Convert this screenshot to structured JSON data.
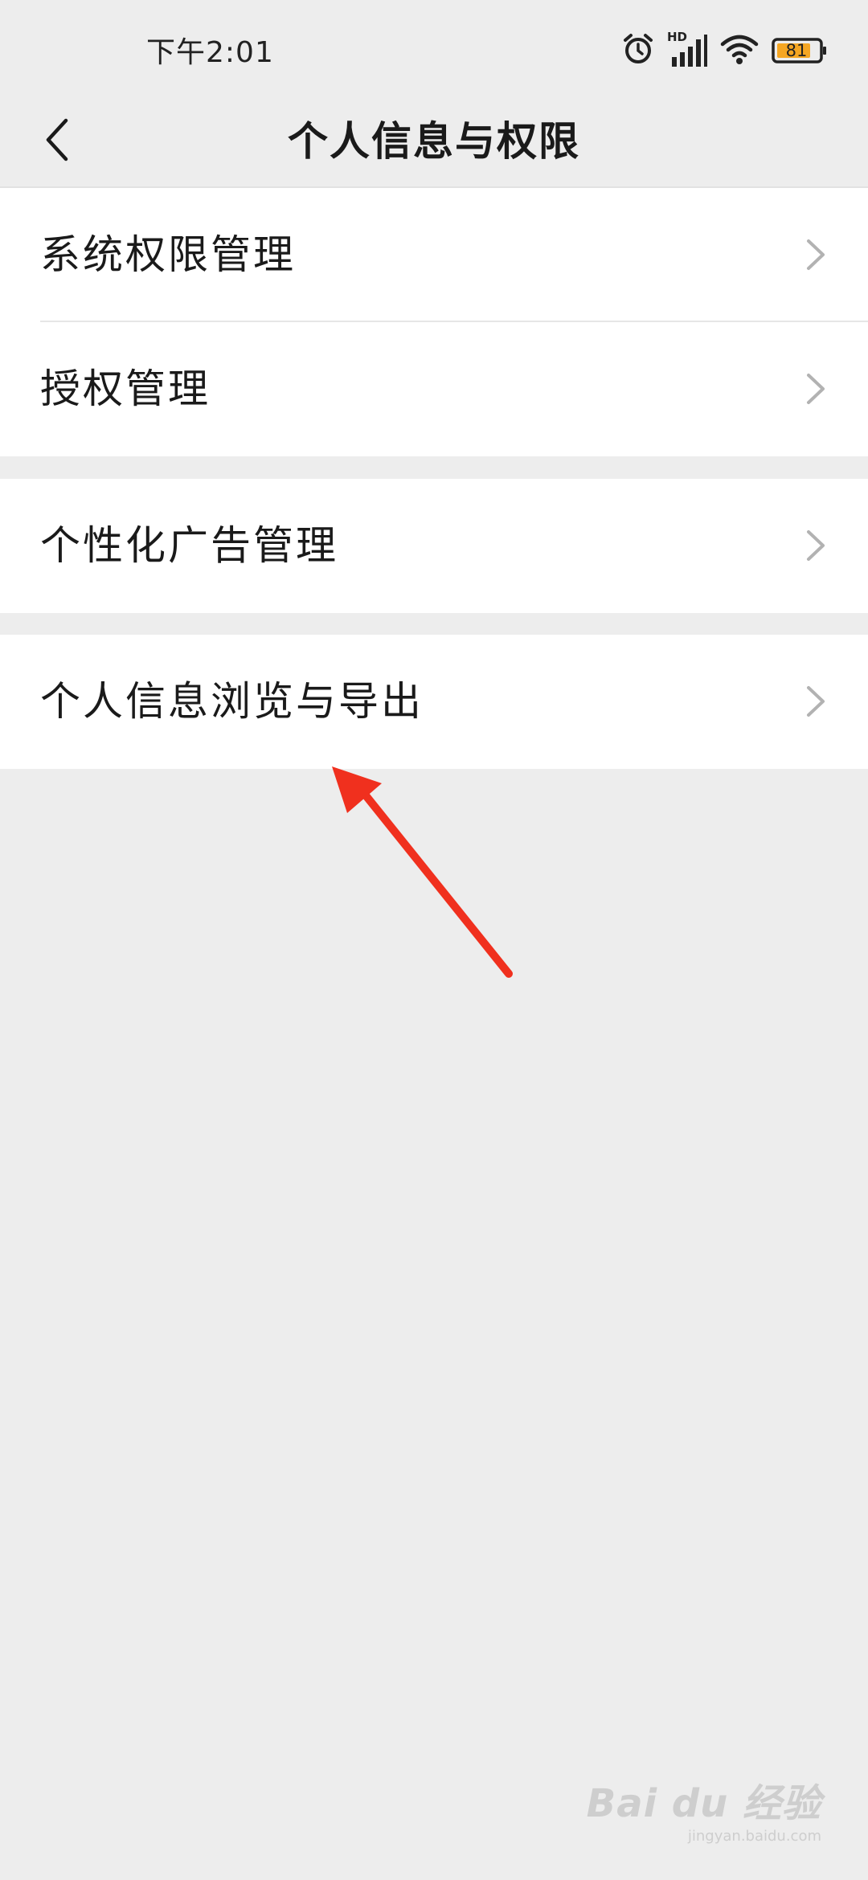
{
  "status_bar": {
    "time": "下午2:01",
    "network_label": "HD",
    "battery_level": "81",
    "icons": [
      "alarm-icon",
      "signal-icon",
      "wifi-icon",
      "battery-icon"
    ]
  },
  "nav": {
    "title": "个人信息与权限",
    "back_icon": "chevron-left-icon"
  },
  "groups": [
    {
      "items": [
        {
          "label": "系统权限管理"
        },
        {
          "label": "授权管理"
        }
      ]
    },
    {
      "items": [
        {
          "label": "个性化广告管理"
        }
      ]
    },
    {
      "items": [
        {
          "label": "个人信息浏览与导出"
        }
      ]
    }
  ],
  "annotation": {
    "color": "#f0301e"
  },
  "watermark": {
    "logo_text": "Bai du 经验",
    "url": "jingyan.baidu.com"
  },
  "colors": {
    "background": "#ededed",
    "card": "#ffffff",
    "text": "#1a1a1a",
    "chevron": "#b2b2b2",
    "battery_fill": "#f5a623"
  }
}
